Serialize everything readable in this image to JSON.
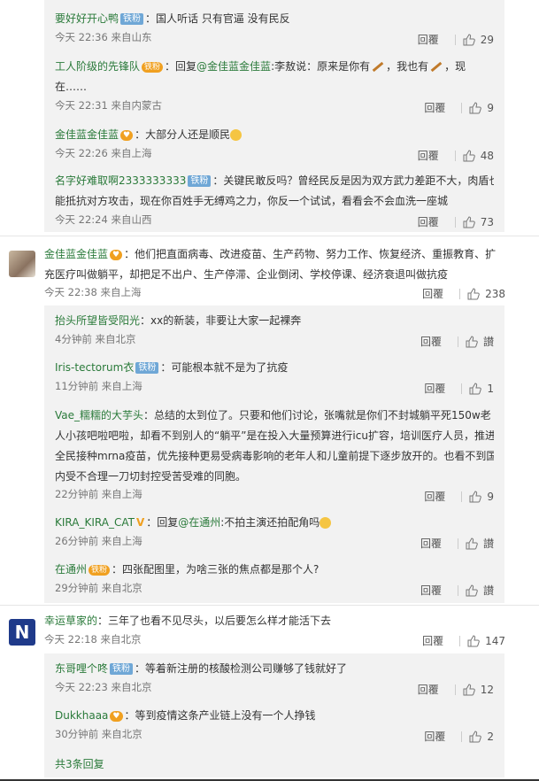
{
  "comments_top": [
    {
      "name": "要好好开心鸭",
      "badge": "铁粉",
      "text": "：国人听话 只有官逼 没有民反",
      "time": "今天 22:36 来自山东",
      "reply": "回覆",
      "likes": "29"
    },
    {
      "name": "工人阶级的先锋队",
      "badge": "铁粉",
      "reply_prefix": "：回复",
      "at": "@金佳蓝金佳蓝",
      "text1": ":李敖说：原来是你有",
      "text2": "，我也有",
      "text3": "，现",
      "text_cont": "在……",
      "time": "今天 22:31 来自内蒙古",
      "reply": "回覆",
      "likes": "9"
    },
    {
      "name": "金佳蓝金佳蓝",
      "text": "：大部分人还是顺民",
      "time": "今天 22:26 来自上海",
      "reply": "回覆",
      "likes": "48"
    },
    {
      "name": "名字好难取啊2333333333",
      "badge": "铁粉",
      "text1": "：关键民敢反吗？曾经民反是因为双方武力差距不大，肉盾也",
      "text2": "能抵抗对方攻击，现在你百姓手无缚鸡之力，你反一个试试，看看会不会血洗一座城",
      "time": "今天 22:24 来自山西",
      "reply": "回覆",
      "likes": "73"
    }
  ],
  "thread1": {
    "name": "金佳蓝金佳蓝",
    "text1": "：他们把直面病毒、改进疫苗、生产药物、努力工作、恢复经济、重振教育、扩",
    "text2": "充医疗叫做躺平，却把足不出户、生产停滞、企业倒闭、学校停课、经济衰退叫做抗疫",
    "time": "今天 22:38 来自上海",
    "reply": "回覆",
    "likes": "238"
  },
  "thread1_replies": [
    {
      "name": "抬头所望皆受阳光",
      "text": "：xx的新装，非要让大家一起裸奔",
      "time": "4分钟前 来自北京",
      "reply": "回覆",
      "likes": "讃"
    },
    {
      "name": "Iris-tectorum衣",
      "badge": "铁粉",
      "text": "：可能根本就不是为了抗疫",
      "time": "11分钟前 来自上海",
      "reply": "回覆",
      "likes": "1"
    },
    {
      "name": "Vae_糯糯的大芋头",
      "text1": "：总结的太到位了。只要和他们讨论，张嘴就是你们不封城躺平死150w老",
      "text2": "人小孩吧啦吧啦，却看不到别人的“躺平”是在投入大量预算进行icu扩容，培训医疗人员，推进",
      "text3": "全民接种mrna疫苗，优先接种更易受病毒影响的老年人和儿童前提下逐步放开的。也看不到国",
      "text4": "内受不合理一刀切封控受苦受难的同胞。",
      "time": "22分钟前 来自上海",
      "reply": "回覆",
      "likes": "9"
    },
    {
      "name": "KIRA_KIRA_CAT",
      "badge": "V",
      "reply_prefix": "：回复",
      "at": "@在通州",
      "text": ":不拍主演还拍配角吗",
      "time": "26分钟前 来自上海",
      "reply": "回覆",
      "likes": "讃"
    },
    {
      "name": "在通州",
      "badge": "铁粉",
      "text": "：四张配图里，为啥三张的焦点都是那个人?",
      "time": "29分钟前 来自北京",
      "reply": "回覆",
      "likes": "讃"
    }
  ],
  "thread2": {
    "name": "幸运草家的",
    "text": "：三年了也看不见尽头，以后要怎么样才能活下去",
    "time": "今天 22:18 来自北京",
    "reply": "回覆",
    "likes": "147"
  },
  "thread2_replies": [
    {
      "name": "东哥哩个咚",
      "badge": "铁粉",
      "text": "：等着新注册的核酸检测公司赚够了钱就好了",
      "time": "今天 22:23 来自北京",
      "reply": "回覆",
      "likes": "12"
    },
    {
      "name": "Dukkhaaa",
      "text": "：等到疫情这条产业链上没有一个人挣钱",
      "time": "30分钟前 来自北京",
      "reply": "回覆",
      "likes": "2"
    }
  ],
  "more_replies": "共3条回复",
  "colors": {
    "name": "#2a7a3a",
    "reply_bg": "#f2f2f2",
    "badge_blue": "#6fa7d6",
    "badge_gold": "#f0a020"
  }
}
